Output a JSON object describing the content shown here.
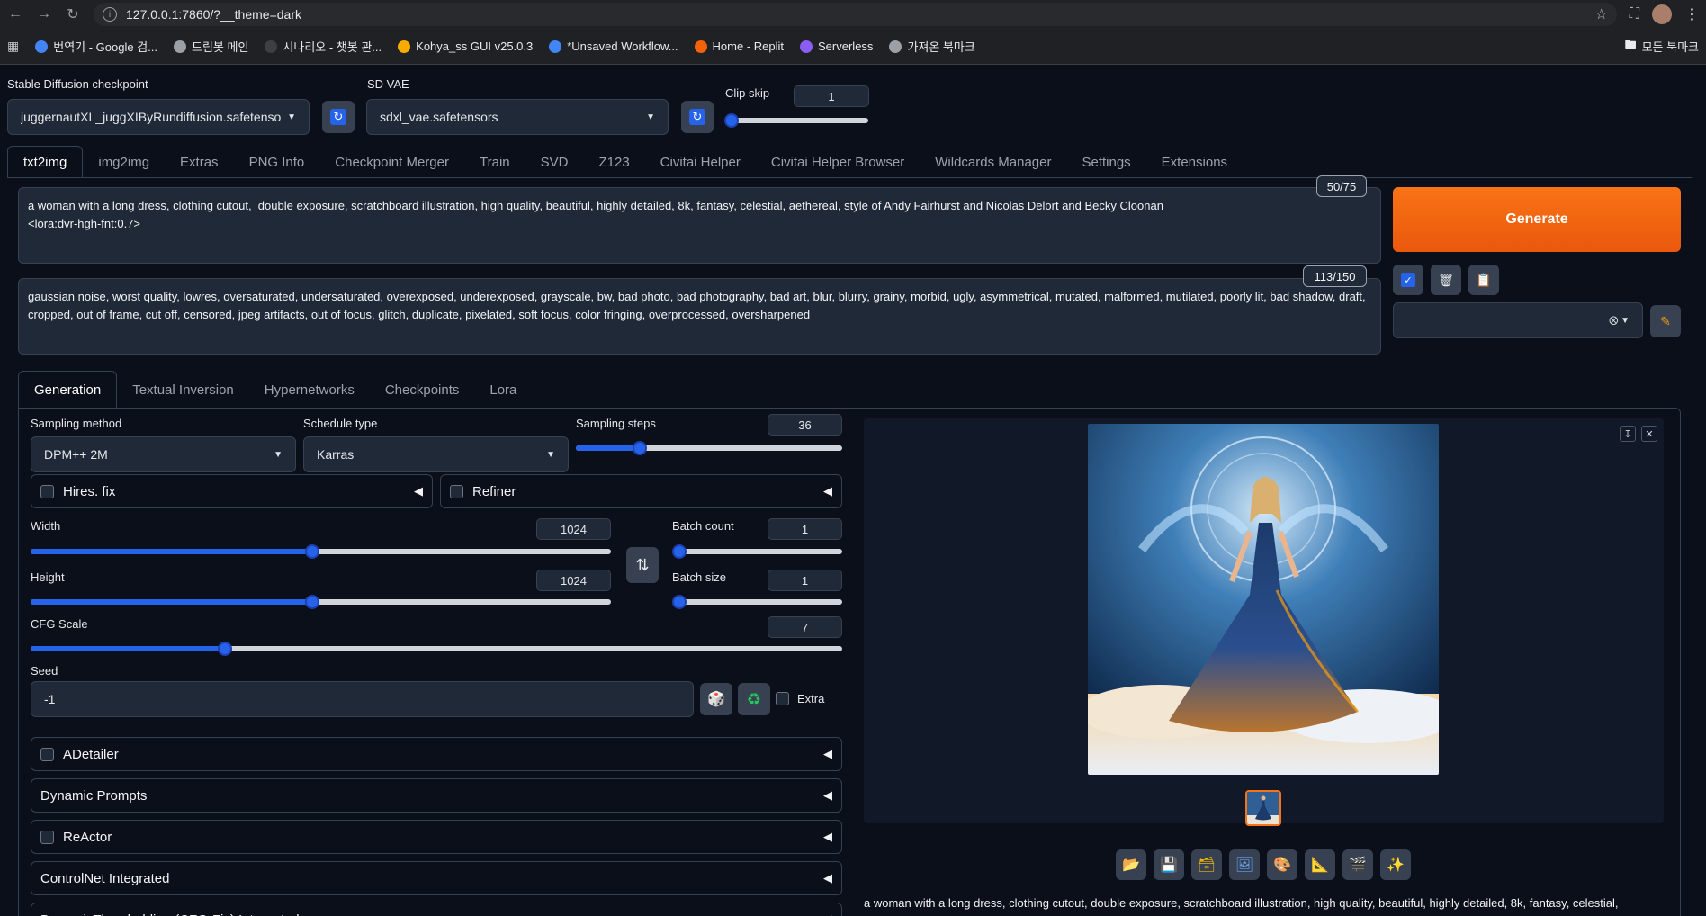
{
  "browser": {
    "url": "127.0.0.1:7860/?__theme=dark",
    "bookmarks": [
      {
        "label": "번역기 - Google 검...",
        "color": "#4285f4"
      },
      {
        "label": "드림봇 메인",
        "color": "#9aa0a6"
      },
      {
        "label": "시나리오 - 챗봇 관...",
        "color": "#3c4043"
      },
      {
        "label": "Kohya_ss GUI v25.0.3",
        "color": "#f9ab00"
      },
      {
        "label": "*Unsaved Workflow...",
        "color": "#4285f4"
      },
      {
        "label": "Home - Replit",
        "color": "#f26207"
      },
      {
        "label": "Serverless",
        "color": "#8b5cf6"
      },
      {
        "label": "가져온 북마크",
        "color": "#9aa0a6"
      }
    ],
    "all_bookmarks": "모든 북마크"
  },
  "top": {
    "checkpoint_label": "Stable Diffusion checkpoint",
    "checkpoint_value": "juggernautXL_juggXIByRundiffusion.safetensor",
    "vae_label": "SD VAE",
    "vae_value": "sdxl_vae.safetensors",
    "clip_skip_label": "Clip skip",
    "clip_skip_value": "1"
  },
  "tabs": [
    "txt2img",
    "img2img",
    "Extras",
    "PNG Info",
    "Checkpoint Merger",
    "Train",
    "SVD",
    "Z123",
    "Civitai Helper",
    "Civitai Helper Browser",
    "Wildcards Manager",
    "Settings",
    "Extensions"
  ],
  "prompt": {
    "positive": "a woman with a long dress, clothing cutout,  double exposure, scratchboard illustration, high quality, beautiful, highly detailed, 8k, fantasy, celestial, aethereal, style of Andy Fairhurst and Nicolas Delort and Becky Cloonan\n<lora:dvr-hgh-fnt:0.7>",
    "positive_count": "50/75",
    "negative": "gaussian noise, worst quality, lowres, oversaturated, undersaturated, overexposed, underexposed, grayscale, bw, bad photo, bad photography, bad art, blur, blurry, grainy, morbid, ugly, asymmetrical, mutated, malformed, mutilated, poorly lit, bad shadow, draft, cropped, out of frame, cut off, censored, jpeg artifacts, out of focus, glitch, duplicate, pixelated, soft focus, color fringing, overprocessed, oversharpened",
    "negative_count": "113/150"
  },
  "generate_label": "Generate",
  "subtabs": [
    "Generation",
    "Textual Inversion",
    "Hypernetworks",
    "Checkpoints",
    "Lora"
  ],
  "generation": {
    "sampling_method_label": "Sampling method",
    "sampling_method_value": "DPM++ 2M",
    "schedule_type_label": "Schedule type",
    "schedule_type_value": "Karras",
    "sampling_steps_label": "Sampling steps",
    "sampling_steps_value": "36",
    "hires_label": "Hires. fix",
    "refiner_label": "Refiner",
    "width_label": "Width",
    "width_value": "1024",
    "height_label": "Height",
    "height_value": "1024",
    "batch_count_label": "Batch count",
    "batch_count_value": "1",
    "batch_size_label": "Batch size",
    "batch_size_value": "1",
    "cfg_label": "CFG Scale",
    "cfg_value": "7",
    "seed_label": "Seed",
    "seed_value": "-1",
    "extra_label": "Extra"
  },
  "accordions": [
    "ADetailer",
    "Dynamic Prompts",
    "ReActor",
    "ControlNet Integrated",
    "DynamicThresholding (CFG-Fix) Integrated"
  ],
  "output_caption": "a woman with a long dress, clothing cutout, double exposure, scratchboard illustration, high quality, beautiful, highly detailed, 8k, fantasy, celestial,",
  "sliders": {
    "clip_skip": 0.0,
    "sampling_steps": 0.24,
    "width": 0.485,
    "height": 0.485,
    "batch_count": 0.0,
    "batch_size": 0.0,
    "cfg": 0.24
  },
  "colors": {
    "accent": "#2563eb",
    "generate": "#f97316",
    "background": "#0b0f19"
  }
}
